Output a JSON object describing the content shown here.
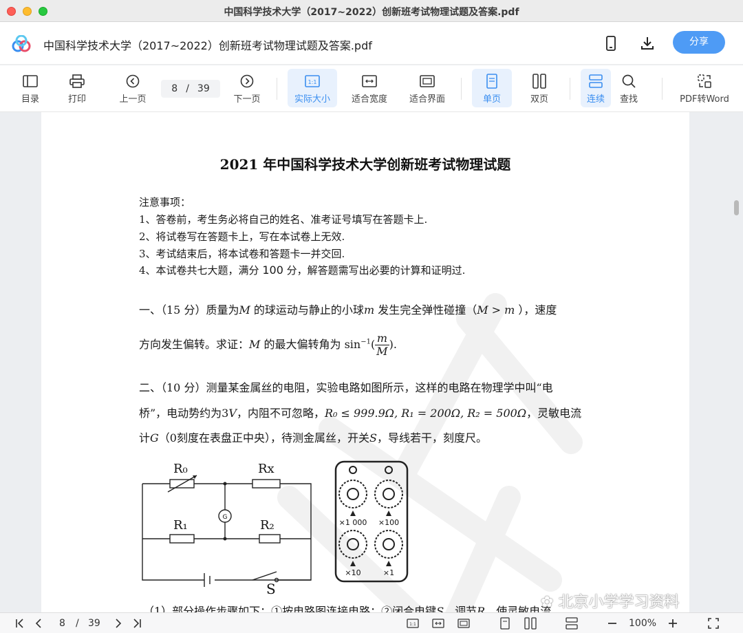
{
  "window": {
    "title": "中国科学技术大学（2017~2022）创新班考试物理试题及答案.pdf"
  },
  "header": {
    "doc_title": "中国科学技术大学（2017~2022）创新班考试物理试题及答案.pdf",
    "share_label": "分享",
    "icons": [
      "mobile-icon",
      "download-icon"
    ]
  },
  "toolbar": {
    "toc": "目录",
    "print": "打印",
    "prev": "上一页",
    "current_page": "8",
    "sep": "/",
    "total_pages": "39",
    "next": "下一页",
    "actual_size": "实际大小",
    "fit_width": "适合宽度",
    "fit_window": "适合界面",
    "single": "单页",
    "double": "双页",
    "continuous": "连续",
    "find": "查找",
    "pdf2word": "PDF转Word",
    "accent_color": "#3a8ef0"
  },
  "document": {
    "title": "2021 年中国科学技术大学创新班考试物理试题",
    "notice_head": "注意事项：",
    "notices": [
      "1、答卷前，考生务必将自己的姓名、准考证号填写在答题卡上.",
      "2、将试卷写在答题卡上，写在本试卷上无效.",
      "3、考试结束后，将本试卷和答题卡一并交回."
    ],
    "notice4_a": "4、本试卷共七大题，满分 ",
    "notice4_b": "100",
    "notice4_c": " 分，解答题需写出必要的计算和证明过.",
    "q1_line1_a": "一、（15 分）质量为",
    "q1_line1_M": "M",
    "q1_line1_b": " 的球运动与静止的小球",
    "q1_line1_m": "m",
    "q1_line1_c": " 发生完全弹性碰撞（",
    "q1_line1_cond": "M > m",
    "q1_line1_d": " ），速度",
    "q1_line2_a": "方向发生偏转。求证：",
    "q1_line2_M": "M",
    "q1_line2_b": " 的最大偏转角为 sin",
    "q1_line2_sup": "−1",
    "q1_frac_num": "m",
    "q1_frac_den": "M",
    "q2_line1": "二、（10 分）测量某金属丝的电阻，实验电路如图所示，这样的电路在物理学中叫“电",
    "q2_line2_a": "桥”，电动势约为3",
    "q2_line2_V": "V",
    "q2_line2_b": "，内阻不可忽略，",
    "q2_line2_c": "R₀ ≤ 999.9Ω, R₁ = 200Ω, R₂ = 500Ω",
    "q2_line2_d": "，灵敏电流",
    "q2_line3_a": "计",
    "q2_line3_G": "G",
    "q2_line3_b": "（0刻度在表盘正中央），待测金属丝，开关",
    "q2_line3_S": "S",
    "q2_line3_c": "，导线若干，刻度尺。",
    "q2_sub1": "（1）部分操作步骤如下：①按电路图连接电路；②闭合电键",
    "q2_sub1_S": "S",
    "q2_sub1_b": "，调节",
    "q2_sub1_R": "R",
    "q2_sub1_c": "，使灵敏电流",
    "circuit_labels": {
      "r0": "R₀",
      "rx": "Rx",
      "r1": "R₁",
      "r2": "R₂",
      "g": "G",
      "s": "S"
    },
    "box_labels": [
      "×1 000",
      "×100",
      "×10",
      "×1"
    ],
    "brand_watermark": "北京小学学习资料"
  },
  "bottombar": {
    "current_page": "8",
    "sep": "/",
    "total_pages": "39",
    "zoom": "100%"
  }
}
